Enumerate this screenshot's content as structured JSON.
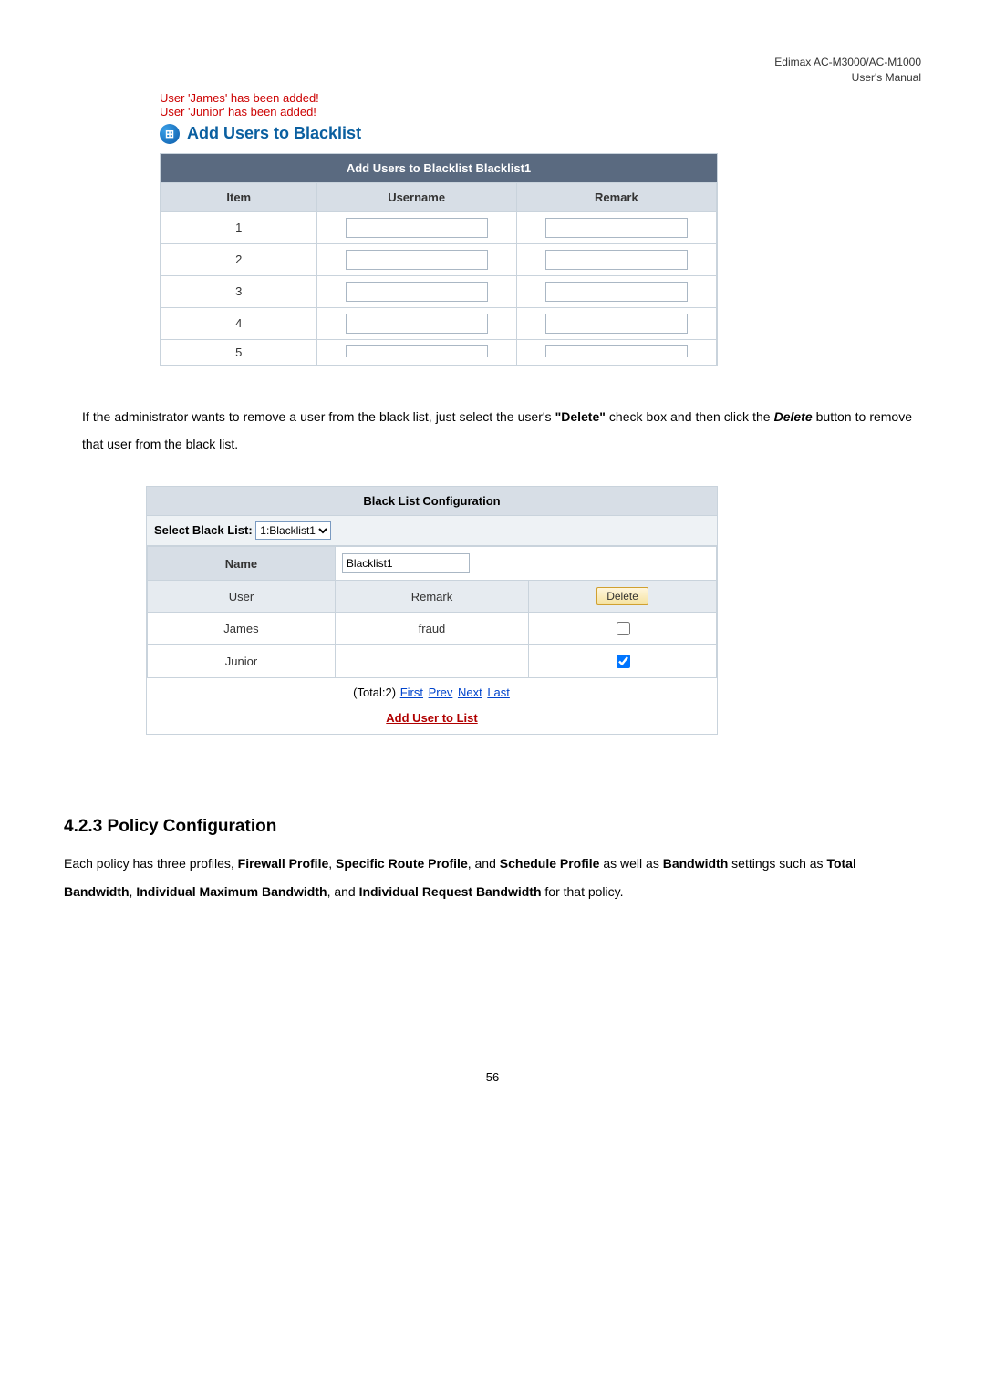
{
  "header": {
    "line1": "Edimax  AC-M3000/AC-M1000",
    "line2": "User's  Manual"
  },
  "status": [
    "User 'James' has been added!",
    "User 'Junior' has been added!"
  ],
  "iconGlyph": "⊞",
  "sectionTitle": "Add Users to Blacklist",
  "addTable": {
    "title": "Add Users to Blacklist Blacklist1",
    "cols": [
      "Item",
      "Username",
      "Remark"
    ],
    "rows": [
      {
        "n": "1",
        "u": "",
        "r": ""
      },
      {
        "n": "2",
        "u": "",
        "r": ""
      },
      {
        "n": "3",
        "u": "",
        "r": ""
      },
      {
        "n": "4",
        "u": "",
        "r": ""
      },
      {
        "n": "5",
        "u": "",
        "r": ""
      }
    ]
  },
  "para1": {
    "pre": "If the administrator wants to remove a user from the black list, just select the user's ",
    "deleteQuote": "\"Delete\"",
    "mid": " check box and then click the ",
    "deleteBtn": "Delete",
    "post": " button to remove that user from the black list."
  },
  "config": {
    "title": "Black List Configuration",
    "selectLabel": "Select Black List:",
    "selectValue": "1:Blacklist1",
    "nameLabel": "Name",
    "nameValue": "Blacklist1",
    "cols": [
      "User",
      "Remark",
      "Delete"
    ],
    "rows": [
      {
        "user": "James",
        "remark": "fraud",
        "checked": false
      },
      {
        "user": "Junior",
        "remark": "",
        "checked": true
      }
    ],
    "pagerTotal": "(Total:2) ",
    "pagerLinks": [
      "First",
      "Prev",
      "Next",
      "Last"
    ],
    "addLink": "Add User to List"
  },
  "heading423": "4.2.3 Policy Configuration",
  "para2": {
    "t1": "Each policy has three profiles, ",
    "b1": "Firewall Profile",
    "t2": ", ",
    "b2": "Specific Route Profile",
    "t3": ", and ",
    "b3": "Schedule Profile",
    "t4": " as well as ",
    "b4": "Bandwidth",
    "t5": " settings such as ",
    "b5": "Total Bandwidth",
    "t6": ", ",
    "b6": "Individual Maximum Bandwidth",
    "t7": ", and ",
    "b7": "Individual Request Bandwidth",
    "t8": " for that policy."
  },
  "pageNumber": "56"
}
